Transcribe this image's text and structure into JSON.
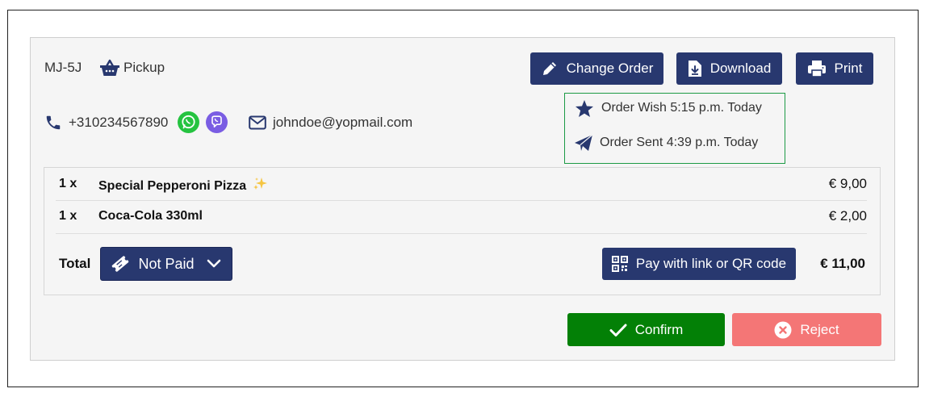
{
  "order": {
    "code": "MJ-5J",
    "type": "Pickup",
    "phone": "+310234567890",
    "email": "johndoe@yopmail.com"
  },
  "actions": {
    "change_order_label": "Change Order",
    "download_label": "Download",
    "print_label": "Print"
  },
  "status": {
    "wish": "Order Wish 5:15 p.m. Today",
    "sent": "Order Sent 4:39 p.m. Today"
  },
  "items": [
    {
      "qty": "1 x",
      "name": "Special Pepperoni Pizza",
      "badge_icon": "sparkles-icon",
      "price": "€ 9,00"
    },
    {
      "qty": "1 x",
      "name": "Coca-Cola 330ml",
      "price": "€ 2,00"
    }
  ],
  "payment": {
    "total_label": "Total",
    "status_label": "Not Paid",
    "pay_link_label": "Pay with link or QR code",
    "total_value": "€ 11,00"
  },
  "footer": {
    "confirm_label": "Confirm",
    "reject_label": "Reject"
  },
  "colors": {
    "navy": "#28386f",
    "confirm_green": "#038006",
    "reject_red": "#f47676",
    "whatsapp_green": "#25c340",
    "viber_purple": "#7a5de3",
    "status_border": "#1c9a45"
  }
}
